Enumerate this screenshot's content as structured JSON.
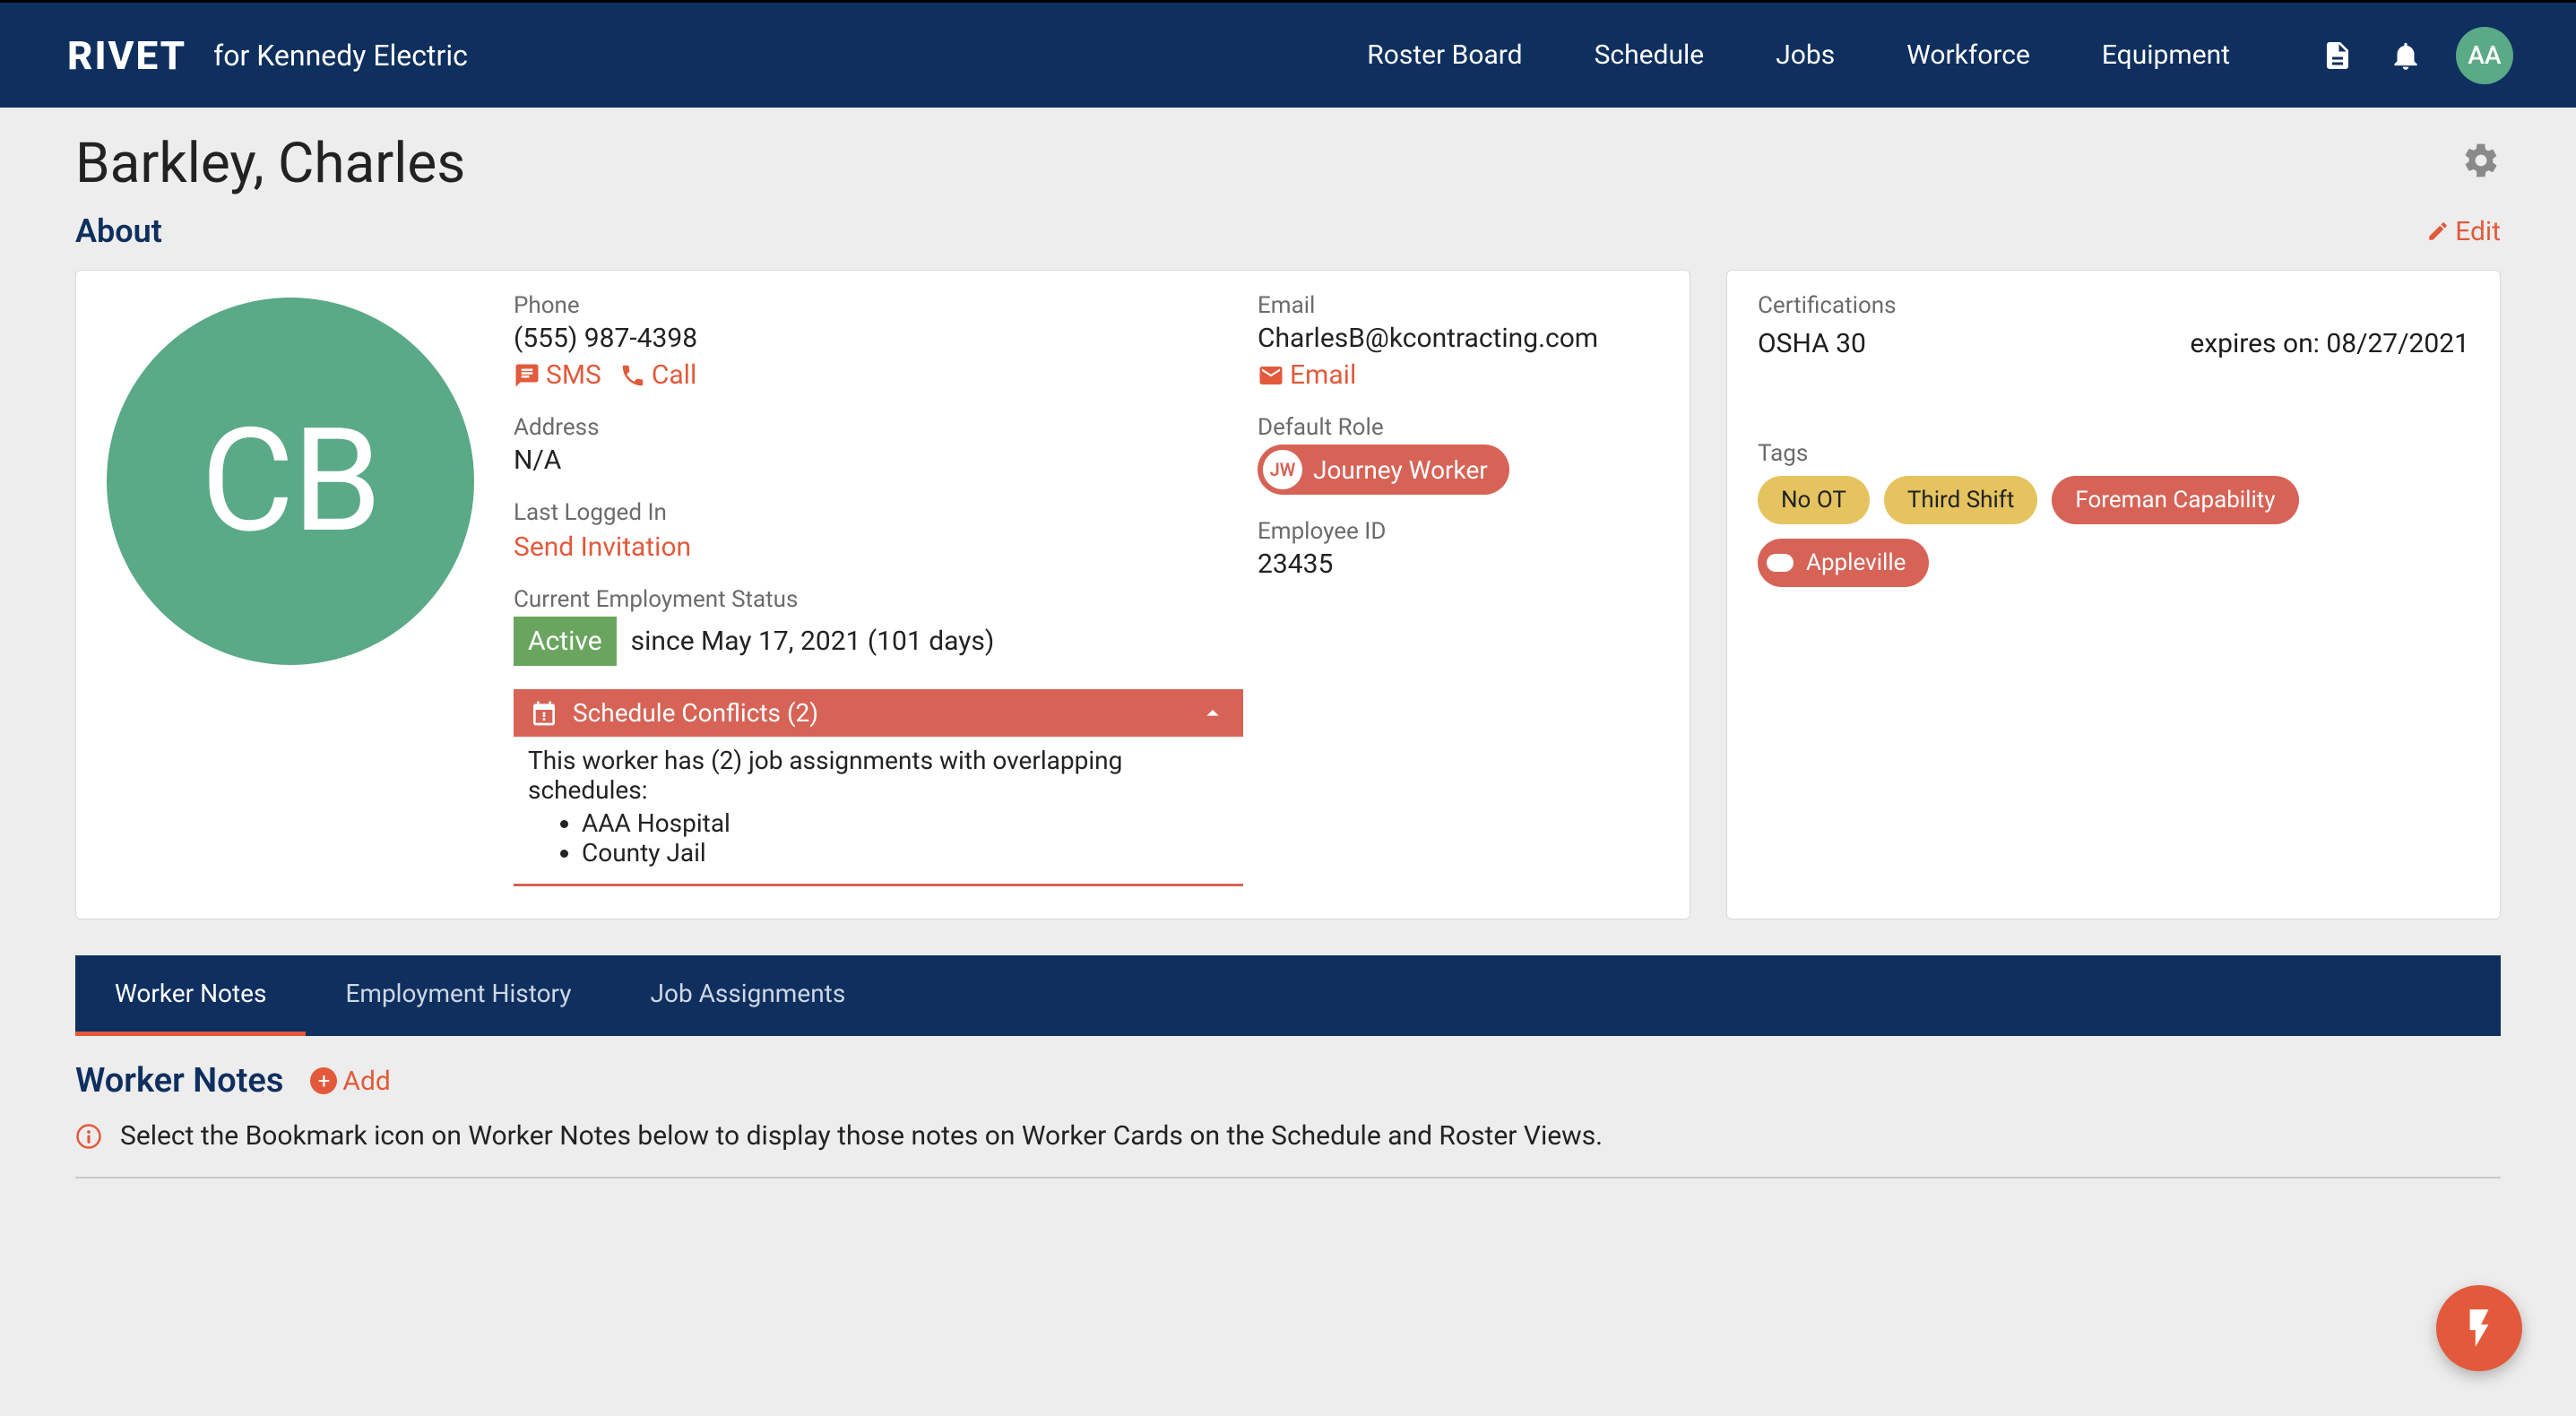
{
  "header": {
    "brand": "RIVET",
    "subtitle": "for Kennedy Electric",
    "nav": [
      "Roster Board",
      "Schedule",
      "Jobs",
      "Workforce",
      "Equipment"
    ],
    "avatar_initials": "AA"
  },
  "page_title": "Barkley, Charles",
  "about": {
    "heading": "About",
    "edit_label": "Edit",
    "avatar_initials": "CB",
    "phone_label": "Phone",
    "phone": "(555) 987-4398",
    "sms_label": "SMS",
    "call_label": "Call",
    "address_label": "Address",
    "address": "N/A",
    "last_login_label": "Last Logged In",
    "send_invitation": "Send Invitation",
    "emp_status_label": "Current Employment Status",
    "status_badge": "Active",
    "status_since": "since May 17, 2021 (101 days)",
    "email_label": "Email",
    "email": "CharlesB@kcontracting.com",
    "email_action": "Email",
    "default_role_label": "Default Role",
    "role_abbr": "JW",
    "role_name": "Journey Worker",
    "employee_id_label": "Employee ID",
    "employee_id": "23435",
    "conflicts": {
      "title": "Schedule Conflicts (2)",
      "body": "This worker has (2) job assignments with overlapping schedules:",
      "items": [
        "AAA Hospital",
        "County Jail"
      ]
    }
  },
  "side": {
    "cert_label": "Certifications",
    "cert_name": "OSHA 30",
    "cert_expires": "expires on: 08/27/2021",
    "tags_label": "Tags",
    "tags": [
      {
        "text": "No OT",
        "style": "yellow"
      },
      {
        "text": "Third Shift",
        "style": "yellow"
      },
      {
        "text": "Foreman Capability",
        "style": "red"
      },
      {
        "text": "Appleville",
        "style": "dot"
      }
    ]
  },
  "tabs": [
    "Worker Notes",
    "Employment History",
    "Job Assignments"
  ],
  "notes": {
    "heading": "Worker Notes",
    "add": "Add",
    "hint": "Select the Bookmark icon on Worker Notes below to display those notes on Worker Cards on the Schedule and Roster Views."
  }
}
